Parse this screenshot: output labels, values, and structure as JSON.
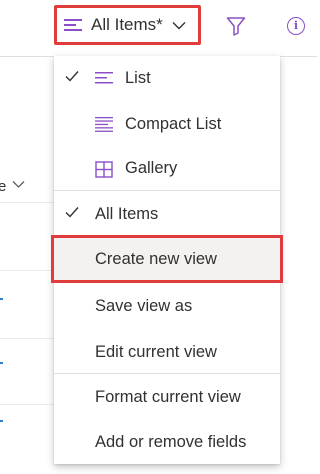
{
  "header": {
    "view_label": "All Items*",
    "colors": {
      "accent": "#8a4ec7",
      "highlight": "#e03c3c"
    },
    "icons": [
      "view-list-icon",
      "chevron-down-icon",
      "filter-icon",
      "info-icon"
    ]
  },
  "background_list": {
    "column_label_fragment": "e"
  },
  "menu": {
    "layouts": [
      {
        "label": "List",
        "icon": "list-icon",
        "checked": true
      },
      {
        "label": "Compact List",
        "icon": "compact-list-icon",
        "checked": false
      },
      {
        "label": "Gallery",
        "icon": "gallery-icon",
        "checked": false
      }
    ],
    "views": [
      {
        "label": "All Items",
        "checked": true
      },
      {
        "label": "Create new view",
        "checked": false,
        "highlighted": true
      },
      {
        "label": "Save view as",
        "checked": false
      },
      {
        "label": "Edit current view",
        "checked": false
      }
    ],
    "formatting": [
      {
        "label": "Format current view"
      },
      {
        "label": "Add or remove fields"
      }
    ]
  }
}
